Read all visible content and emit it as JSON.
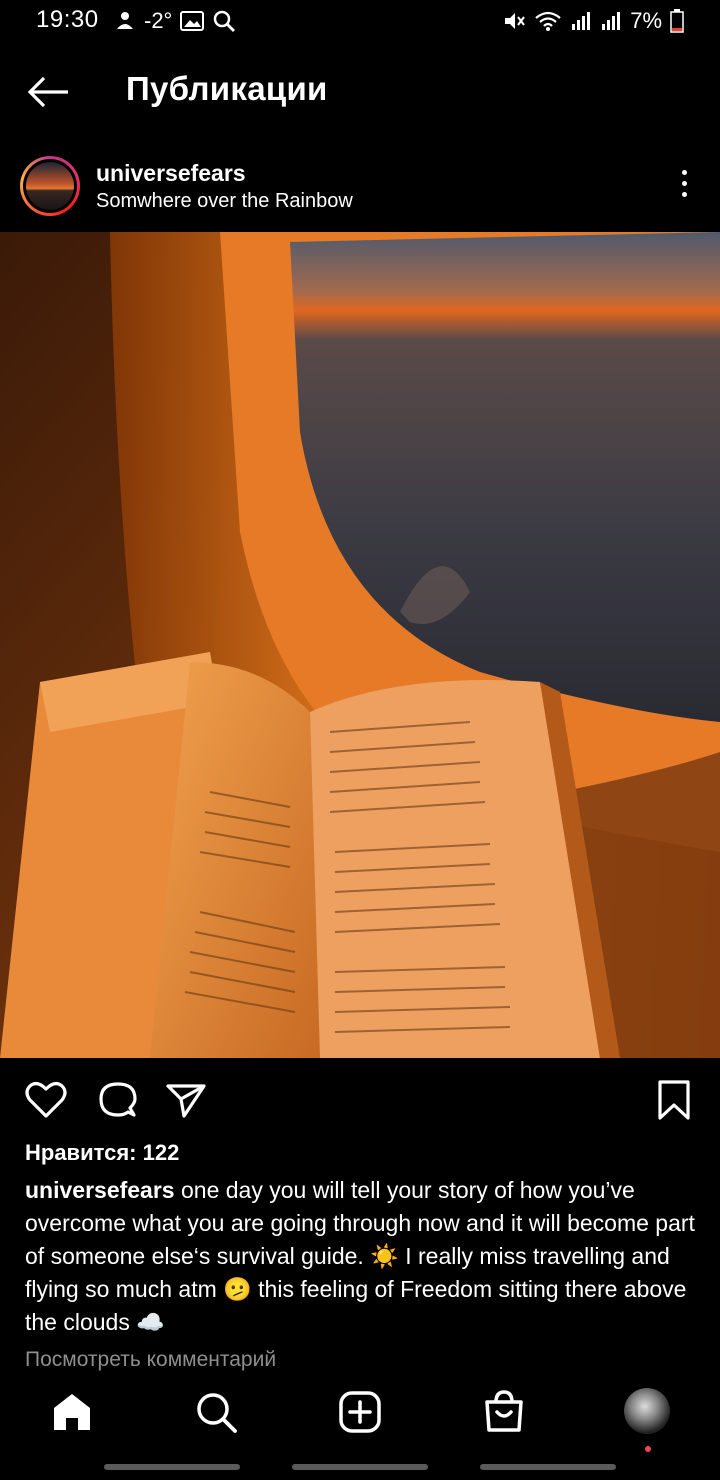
{
  "status_bar": {
    "time": "19:30",
    "temperature": "-2°",
    "battery": "7%",
    "left_icons": [
      "weather-icon",
      "gallery-icon",
      "search-icon"
    ],
    "right_icons": [
      "mute-icon",
      "wifi-icon",
      "signal-icon",
      "signal-icon",
      "battery-icon"
    ]
  },
  "header": {
    "title": "Публикации"
  },
  "post": {
    "username": "universefears",
    "location": "Somwhere over the Rainbow",
    "likes": "Нравится: 122",
    "caption_user": "universefears",
    "caption_text": " one day you will tell your story of how you’ve overcome what you are going through now and it will become part of someone else‘s survival guide. ☀️ I really miss travelling and flying so much atm 🫤 this feeling of Freedom sitting there above the clouds ☁️",
    "view_comments": "Посмотреть комментарий"
  },
  "colors": {
    "background": "#000000",
    "text": "#ffffff",
    "muted": "#8e8e8e",
    "notification": "#ed4956"
  },
  "bottom_nav": [
    "home-icon",
    "search-icon",
    "new-post-icon",
    "shop-icon",
    "profile-avatar"
  ]
}
